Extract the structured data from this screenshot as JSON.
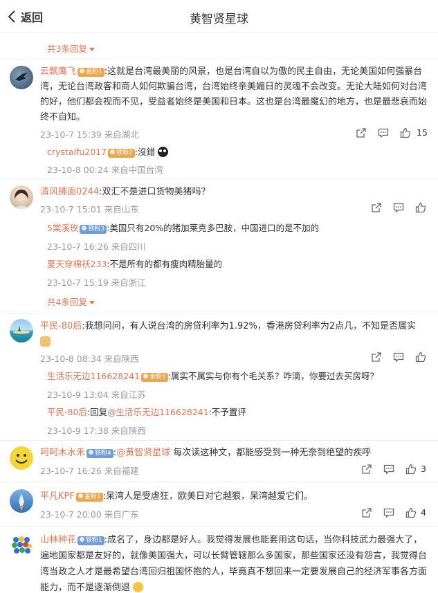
{
  "header": {
    "back_label": "返回",
    "title": "黄智贤星球"
  },
  "top_more": "共3条回复",
  "comments": [
    {
      "name": "云飘鹰飞",
      "badge": "金粉1",
      "text": ":这就是台湾最美丽的风景，也是台湾自以为傲的民主自由，无论美国如何强暴台湾，无论台湾政客和商人如何欺骗台湾，台湾始终亲美媚日的灵魂不会改变。无论大陆如何对台湾的好，他们都会视而不见，受益者始终是美国和日本。这也是台湾最魔幻的地方，也是最悲哀而始终不自知。",
      "meta": "23-10-7 15:39 来自湖北",
      "likes": "15",
      "replies": [
        {
          "name": "crystalfu2017",
          "badge": "铁粉2",
          "text": ":沒錯",
          "meta": "23-10-8 00:24 来自中国台湾"
        }
      ]
    },
    {
      "name": "清风拂面0244",
      "text": ":双汇不是进口货物美猪吗？",
      "meta": "23-10-7 15:01 来自山东",
      "likes": "",
      "replies": [
        {
          "name": "5棠溪玫",
          "badge": "铁粉3",
          "text": ":美国只有20%的猪加莱克多巴胺，中国进口的是不加的",
          "meta": "23-10-7 16:26 来自四川"
        },
        {
          "name": "夏天穿棉袄233",
          "text": ":不是所有的都有瘦肉精胎量的",
          "meta": "23-10-7 15:19 来自浙江"
        }
      ],
      "more": "共4条回复"
    },
    {
      "name": "平民-80后",
      "text": ":我想问问，有人说台湾的房贷利率为1.92%，香港房贷利率为2点几，不知是否属实",
      "meta": "23-10-8 08:34 来自陕西",
      "likes": "",
      "replies": [
        {
          "name": "生活乐无边116628241",
          "badge": "金粉1",
          "text": ":属实不属实与你有个毛关系？咋滴，你要过去买房呀？",
          "meta": "23-10-9 13:04 来自江苏"
        },
        {
          "name": "平民-80后",
          "text_prefix": ":回复",
          "mention": "@生活乐无边116628241",
          "text": ":不予置评",
          "meta": "23-10-9 17:38 来自陕西"
        }
      ]
    },
    {
      "name": "呵呵木水禾",
      "badge": "铁粉4",
      "text_prefix": ":",
      "mention": "@黄智贤星球",
      "text": " 每次读这种文，都能感受到一种无奈到绝望的疾呼",
      "meta": "23-10-7 16:26 来自福建",
      "likes": "3"
    },
    {
      "name": "平凡KPF",
      "badge": "金粉1",
      "text": ":呆湾人是受虐狂，欧美日对它越狠，呆湾越爱它们。",
      "meta": "23-10-7 20:00 来自广东",
      "likes": "4"
    },
    {
      "name": "山林种花",
      "badge": "铁粉1",
      "text": ":成名了，身边都是好人。我觉得发展也能套用这句话，当你科技武力最强大了，遍地国家都是友好的，就像美国强大，可以长臂管辖那么多国家，那些国家还没有怨言，我觉得台湾当政之人才是最希望台湾回归祖国怀抱的人，毕竟真不想回来一定要发展自己的经济军事各方面能力，而不是逐渐倒退"
    }
  ],
  "colors": {
    "accent": "#eb7350",
    "meta": "#999999",
    "text": "#333333"
  }
}
